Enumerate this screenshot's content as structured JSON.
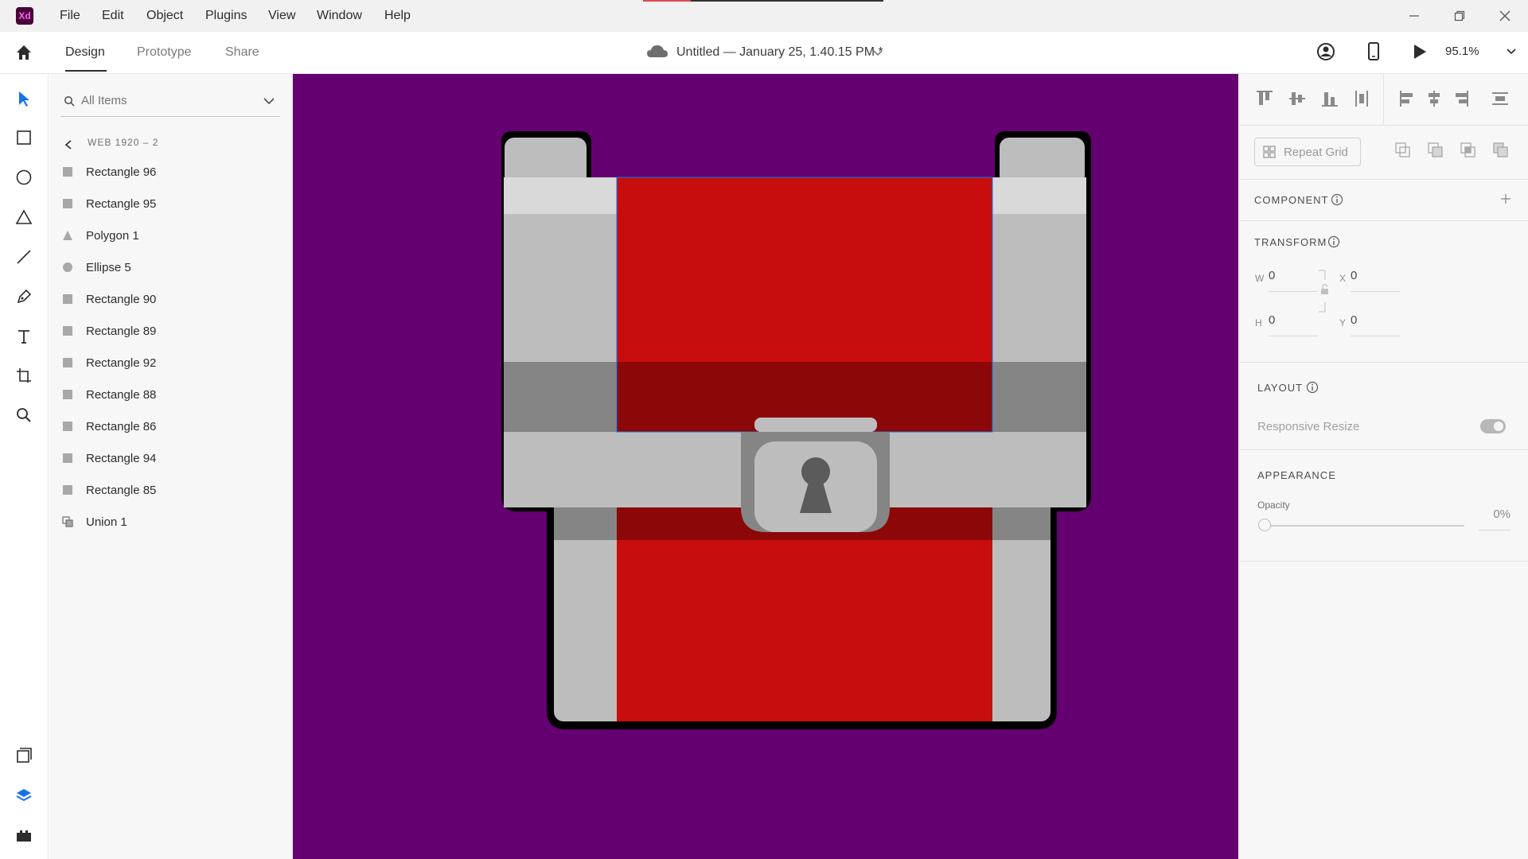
{
  "app": {
    "logo_text": "Xd"
  },
  "menu": [
    "File",
    "Edit",
    "Object",
    "Plugins",
    "View",
    "Window",
    "Help"
  ],
  "tabs": [
    "Design",
    "Prototype",
    "Share"
  ],
  "document": {
    "title": "Untitled — January 25, 1.40.15 PM *"
  },
  "zoom": "95.1%",
  "layers_panel": {
    "search_placeholder": "All Items",
    "artboard": "WEB 1920 – 2",
    "items": [
      {
        "label": "Rectangle 96",
        "icon": "rectangle-icon"
      },
      {
        "label": "Rectangle 95",
        "icon": "rectangle-icon"
      },
      {
        "label": "Polygon 1",
        "icon": "polygon-icon"
      },
      {
        "label": "Ellipse 5",
        "icon": "ellipse-icon"
      },
      {
        "label": "Rectangle 90",
        "icon": "rectangle-icon"
      },
      {
        "label": "Rectangle 89",
        "icon": "rectangle-icon"
      },
      {
        "label": "Rectangle 92",
        "icon": "rectangle-icon"
      },
      {
        "label": "Rectangle 88",
        "icon": "rectangle-icon"
      },
      {
        "label": "Rectangle 86",
        "icon": "rectangle-icon"
      },
      {
        "label": "Rectangle 94",
        "icon": "rectangle-icon"
      },
      {
        "label": "Rectangle 85",
        "icon": "rectangle-icon"
      },
      {
        "label": "Union 1",
        "icon": "union-icon"
      }
    ]
  },
  "inspector": {
    "repeat_grid": "Repeat Grid",
    "component": "COMPONENT",
    "transform": "TRANSFORM",
    "w_label": "W",
    "w_value": "0",
    "x_label": "X",
    "x_value": "0",
    "h_label": "H",
    "h_value": "0",
    "y_label": "Y",
    "y_value": "0",
    "layout": "LAYOUT",
    "responsive_resize": "Responsive Resize",
    "appearance": "APPEARANCE",
    "opacity_label": "Opacity",
    "opacity_value": "0%"
  },
  "colors": {
    "canvas": "#650070",
    "chest_red": "#c70d0d",
    "chest_dark_red": "#8c0707",
    "chest_gray": "#bdbdbd",
    "chest_dark_gray": "#858585",
    "accent": "#1473e6"
  }
}
